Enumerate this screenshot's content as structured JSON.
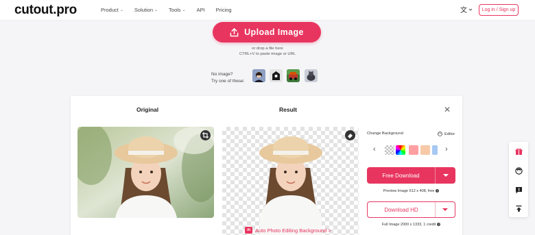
{
  "header": {
    "logo": "cutout.pro",
    "nav": [
      {
        "label": "Product",
        "caret": true
      },
      {
        "label": "Solution",
        "caret": true
      },
      {
        "label": "Tools",
        "caret": true
      },
      {
        "label": "API",
        "caret": false
      },
      {
        "label": "Pricing",
        "caret": false
      }
    ],
    "lang_icon": "translate-icon",
    "login_label": "Log in / Sign up"
  },
  "upload": {
    "button_label": "Upload Image",
    "hint1": "or drop a file here",
    "hint2": "CTRL+V to paste image or URL"
  },
  "samples": {
    "line1": "No image?",
    "line2": "Try one of these:"
  },
  "result_panel": {
    "original_title": "Original",
    "result_title": "Result",
    "auto_link": "Auto Photo Editing Background >",
    "auto_icon_text": "AI",
    "change_bg": "Change Background",
    "editor": "Editor",
    "free_download": "Free Download",
    "preview_note": "Preview Image 612 x 408, free",
    "download_hd": "Download HD",
    "full_note": "Full Image 2000 x 1333, 1 credit"
  },
  "colors": {
    "accent": "#e8355f",
    "swatches": [
      "#ff9fa2",
      "#f7c9a8",
      "#a6c8f2"
    ]
  }
}
